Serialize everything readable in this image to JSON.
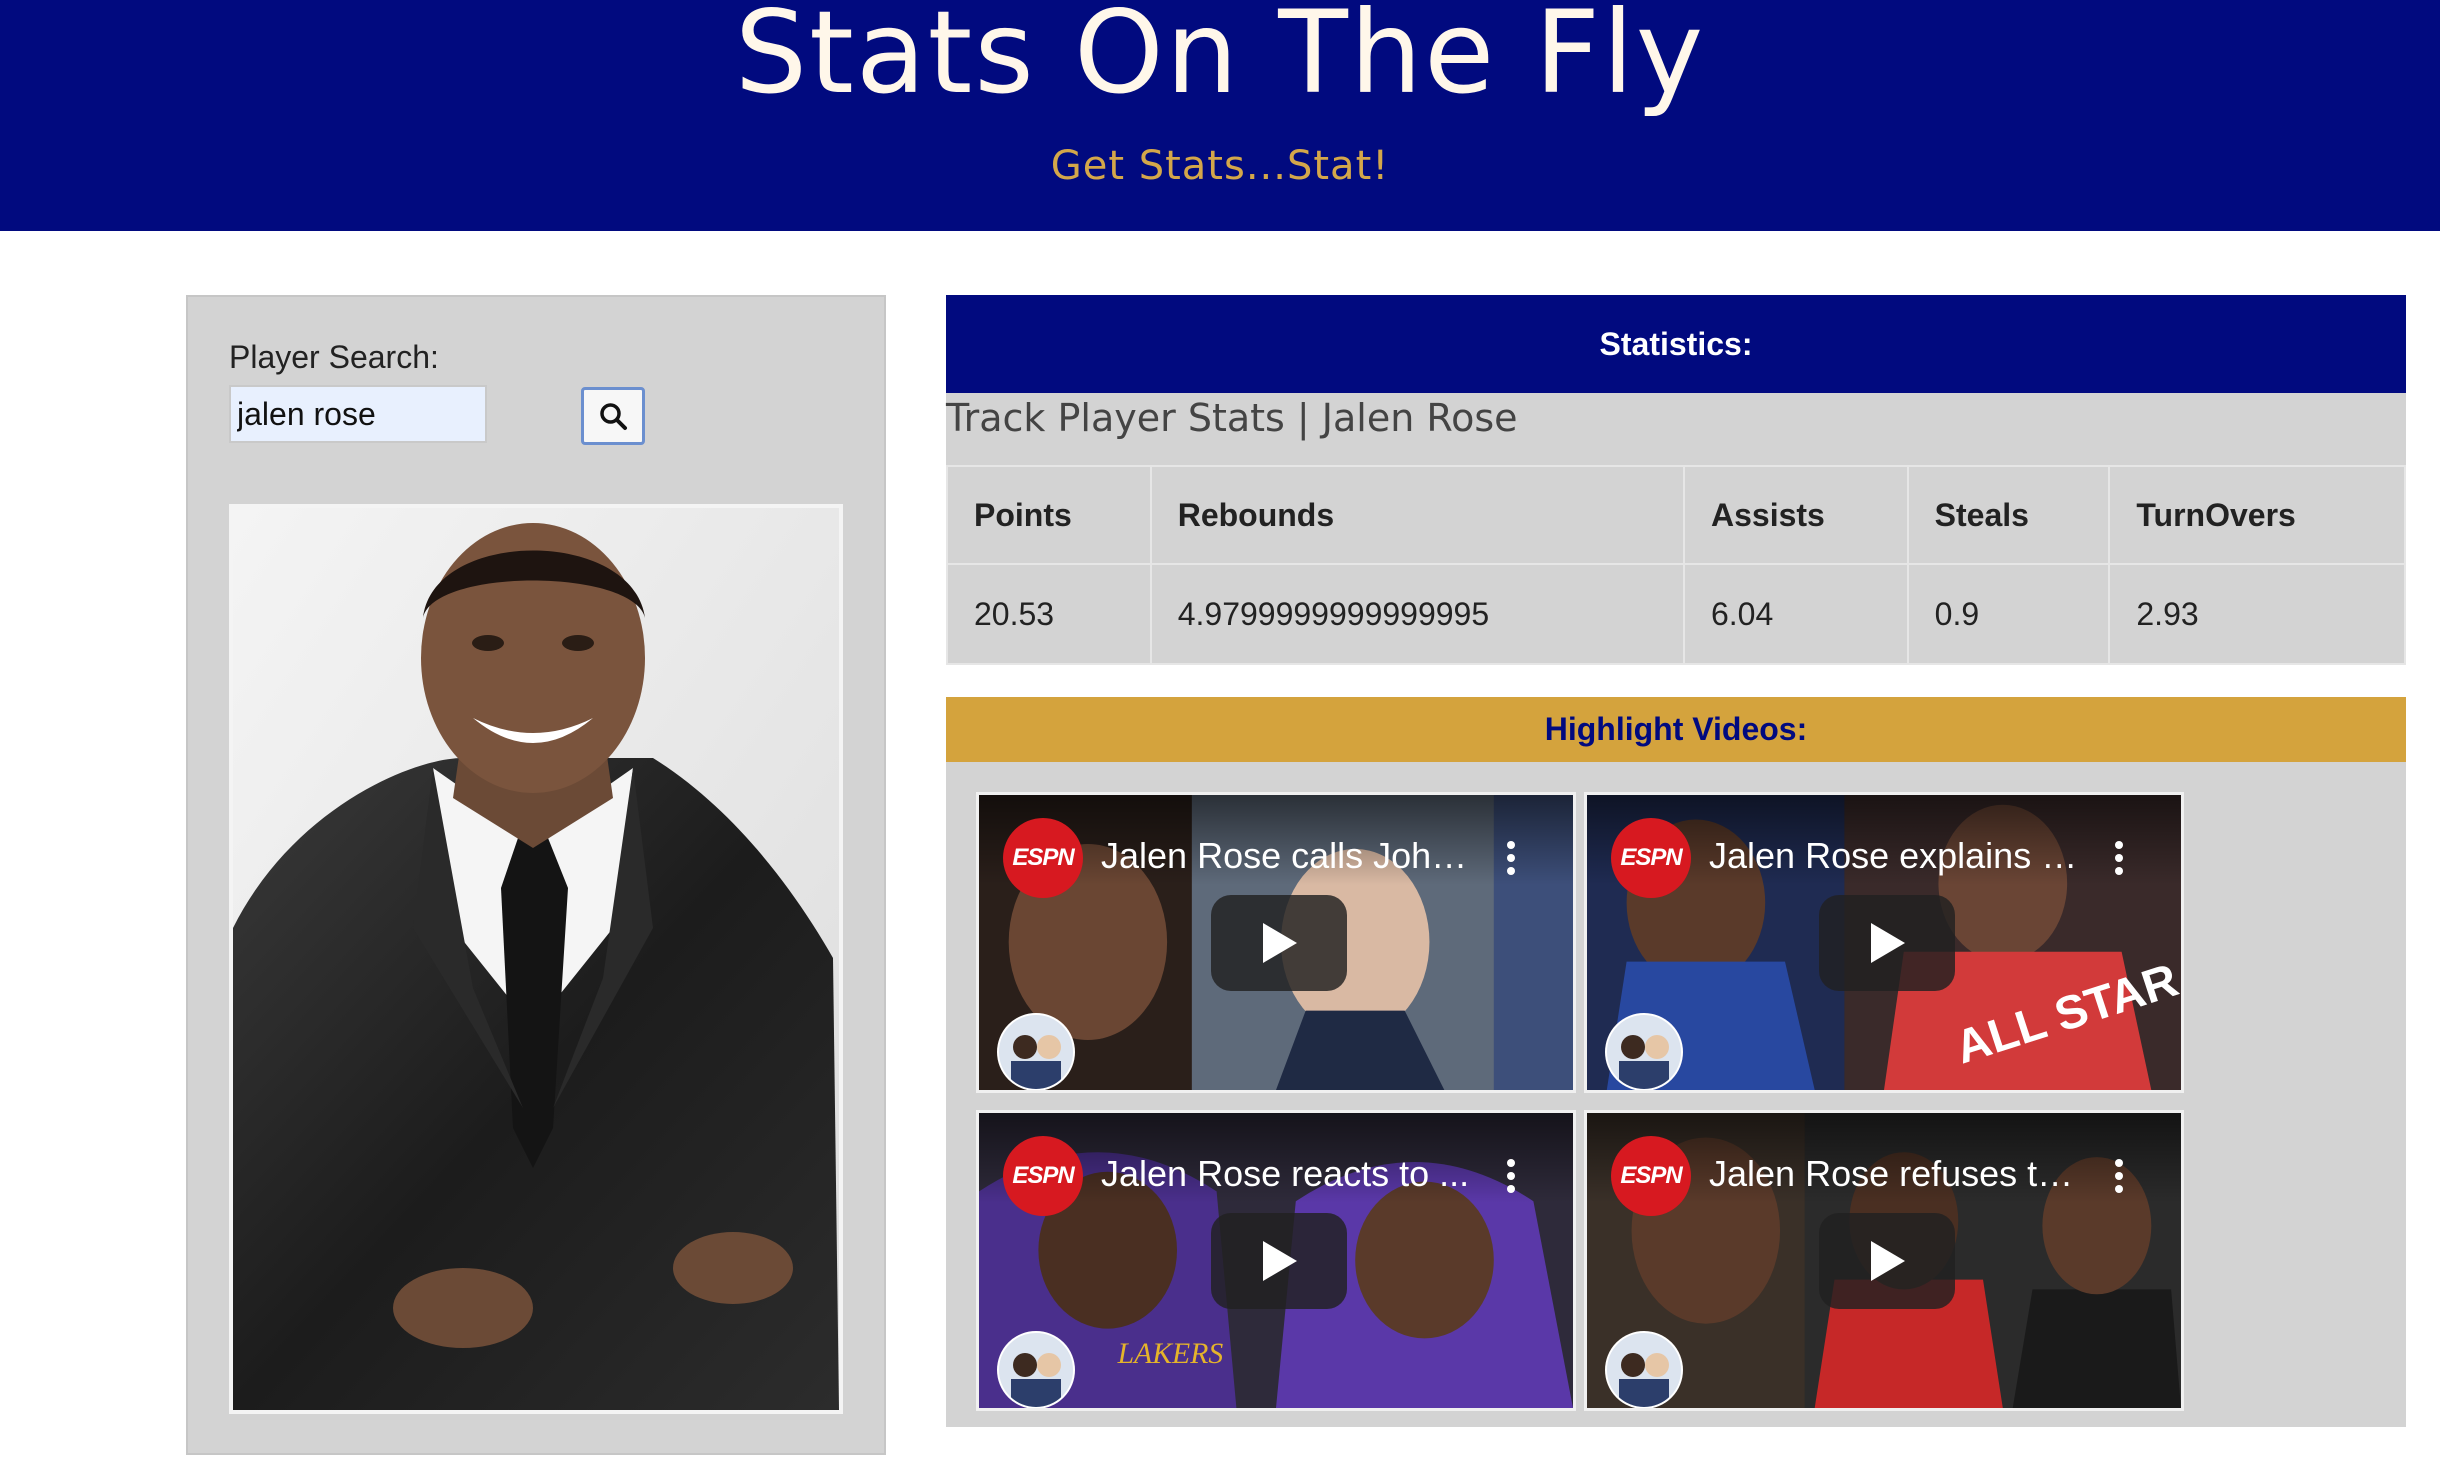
{
  "header": {
    "title": "Stats On The Fly",
    "tagline": "Get Stats...Stat!"
  },
  "search": {
    "label": "Player Search:",
    "value": "jalen rose",
    "button_icon": "search-icon"
  },
  "statistics": {
    "header": "Statistics:",
    "title": "Track Player Stats | Jalen Rose",
    "columns": [
      "Points",
      "Rebounds",
      "Assists",
      "Steals",
      "TurnOvers"
    ],
    "values": [
      "20.53",
      "4.9799999999999995",
      "6.04",
      "0.9",
      "2.93"
    ]
  },
  "highlights": {
    "header": "Highlight Videos:",
    "channel_logo_text": "ESPN",
    "videos": [
      {
        "title": "Jalen Rose calls John..."
      },
      {
        "title": "Jalen Rose explains w..."
      },
      {
        "title": "Jalen Rose reacts to ..."
      },
      {
        "title": "Jalen Rose refuses to ..."
      }
    ]
  },
  "colors": {
    "header_bg": "#010a7f",
    "tagline": "#d4a74a",
    "panel_bg": "#d3d3d3",
    "highlight_bar": "#d4a33d",
    "espn_red": "#d71920"
  }
}
